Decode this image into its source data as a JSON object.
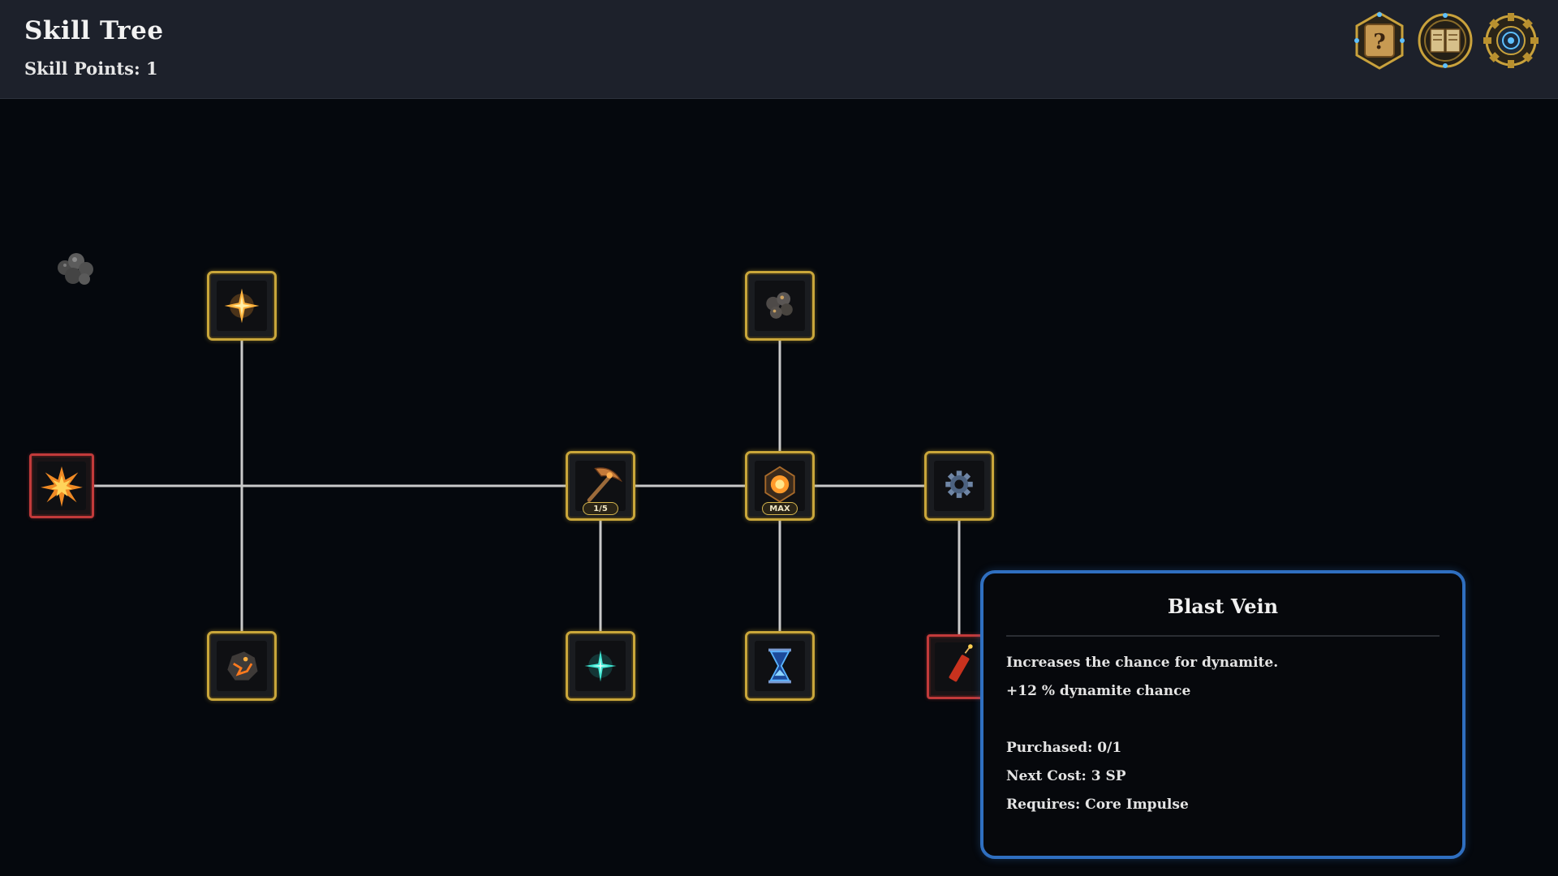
{
  "header": {
    "title": "Skill Tree",
    "skill_points": "Skill Points: 1"
  },
  "toolbar": {
    "buttons": [
      {
        "name": "help-button",
        "icon": "question-scroll-icon"
      },
      {
        "name": "codex-button",
        "icon": "spellbook-icon"
      },
      {
        "name": "settings-button",
        "icon": "gear-icon"
      }
    ]
  },
  "nodes": {
    "ignite": {
      "icon": "explosion-icon",
      "state": "locked"
    },
    "star_spark": {
      "icon": "sparkle-star-icon",
      "state": "available"
    },
    "magma_rock": {
      "icon": "molten-rock-icon",
      "state": "available"
    },
    "pickaxe": {
      "icon": "pickaxe-icon",
      "state": "available",
      "badge": "1/5"
    },
    "teal_spark": {
      "icon": "teal-sparkle-icon",
      "state": "available"
    },
    "ore_cluster": {
      "icon": "ore-cluster-icon",
      "state": "available"
    },
    "core_impulse": {
      "icon": "glowing-core-icon",
      "state": "maxed",
      "badge": "MAX"
    },
    "hourglass": {
      "icon": "hourglass-icon",
      "state": "available"
    },
    "gear": {
      "icon": "gear-icon",
      "state": "available"
    },
    "blast_vein": {
      "icon": "dynamite-icon",
      "state": "locked"
    }
  },
  "tooltip": {
    "title": "Blast Vein",
    "description": "Increases the chance for dynamite.",
    "effect": "+12 % dynamite chance",
    "purchased": "Purchased: 0/1",
    "next_cost": "Next Cost: 3 SP",
    "requires": "Requires: Core Impulse"
  },
  "colors": {
    "node_border": "#c9a63a",
    "locked_border": "#c23a3a",
    "tooltip_border": "#2f6fc0",
    "connector": "#c9c9c9"
  }
}
